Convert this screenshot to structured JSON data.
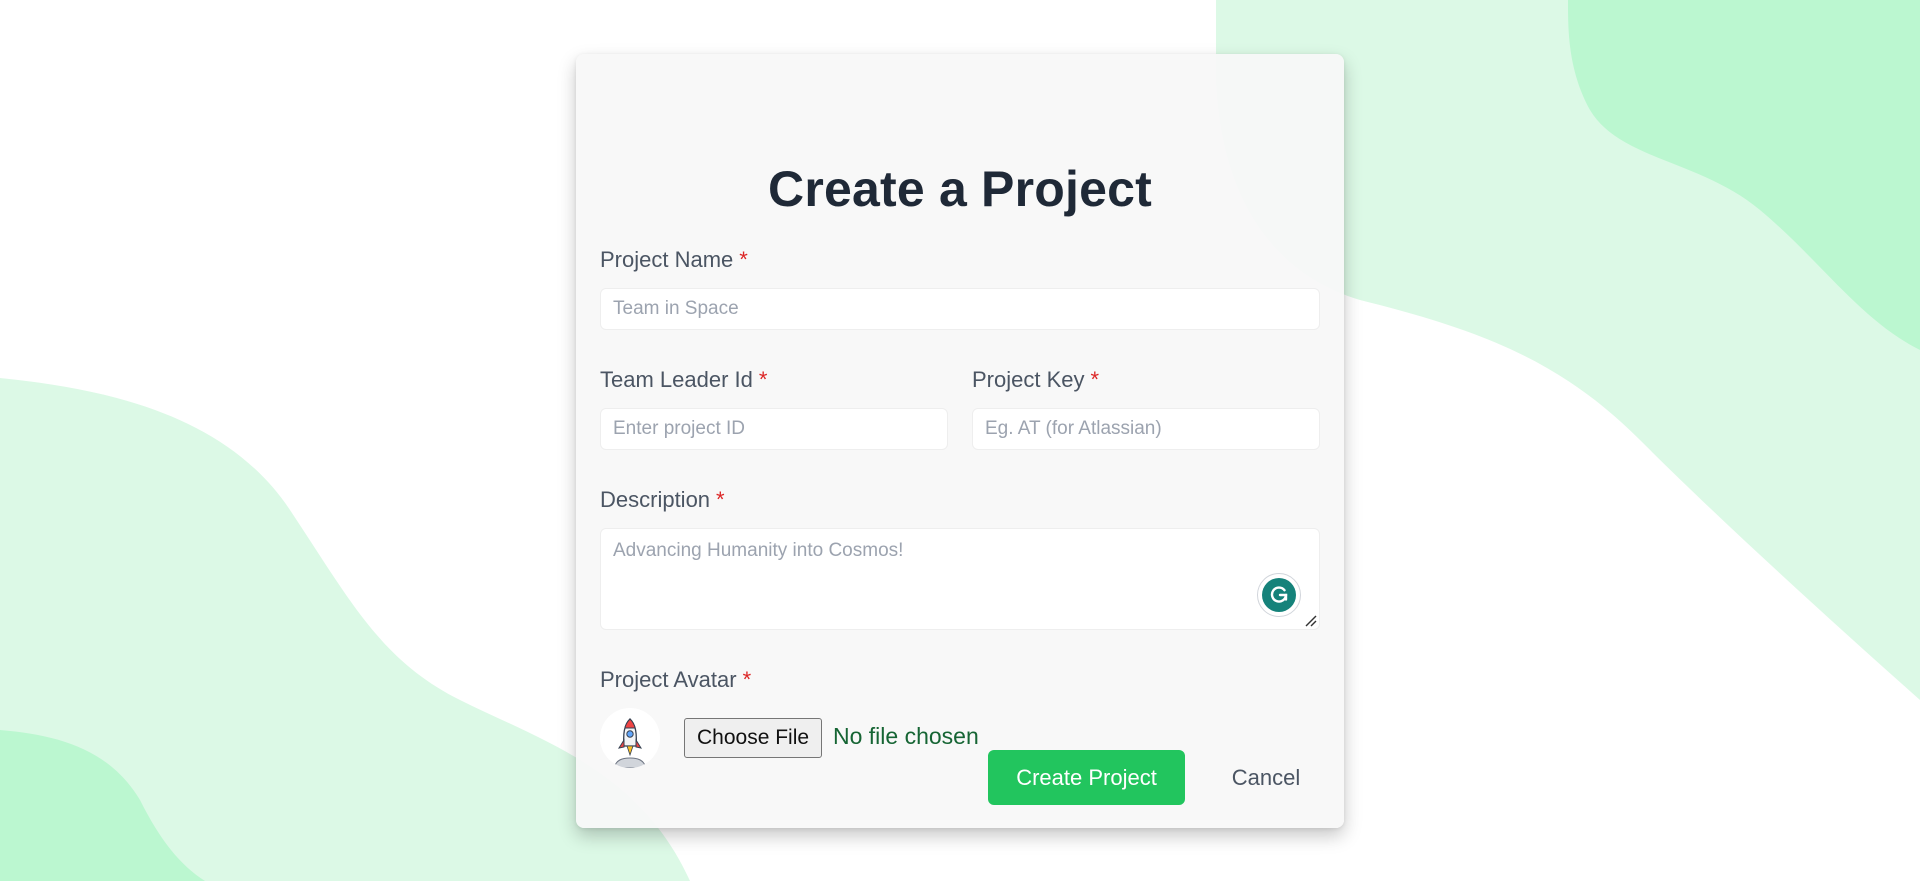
{
  "colors": {
    "accent": "#22c55e",
    "required": "#dc2626",
    "heading": "#1f2937",
    "label": "#4b5563",
    "placeholder": "#9ca3af",
    "file_status": "#166534",
    "background_blob": "#dcf9e6",
    "background_blob_dark": "#bbf7d0"
  },
  "form": {
    "title": "Create a Project",
    "required_marker": "*",
    "project_name": {
      "label": "Project Name",
      "placeholder": "Team in Space",
      "value": ""
    },
    "team_leader_id": {
      "label": "Team Leader Id",
      "placeholder": "Enter project ID",
      "value": ""
    },
    "project_key": {
      "label": "Project Key",
      "placeholder": "Eg. AT (for Atlassian)",
      "value": ""
    },
    "description": {
      "label": "Description",
      "placeholder": "Advancing Humanity into Cosmos!",
      "value": ""
    },
    "project_avatar": {
      "label": "Project Avatar",
      "avatar_icon": "rocket-icon",
      "choose_file_label": "Choose File",
      "file_status": "No file chosen"
    },
    "actions": {
      "create_label": "Create Project",
      "cancel_label": "Cancel"
    }
  },
  "icons": {
    "grammarly": "grammarly-icon",
    "resize": "resize-grip-icon"
  }
}
